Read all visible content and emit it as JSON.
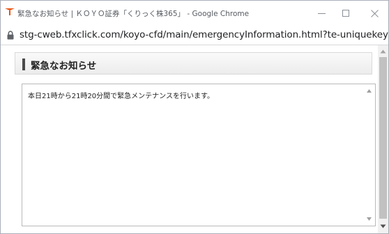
{
  "window": {
    "title": "緊急なお知らせ | ＫＯＹＯ証券「くりっく株365」 - Google Chrome",
    "app_icon": "koyo-logo-icon",
    "controls": {
      "minimize": "minimize-icon",
      "maximize": "maximize-icon",
      "close": "close-icon"
    }
  },
  "address_bar": {
    "secure_icon": "lock-icon",
    "url": "stg-cweb.tfxclick.com/koyo-cfd/main/emergencyInformation.html?te-uniquekey=173..."
  },
  "page": {
    "heading": "緊急なお知らせ",
    "notice": {
      "message": "本日21時から21時20分間で緊急メンテナンスを行います。"
    }
  },
  "colors": {
    "brand": "#e8510f",
    "header_marker": "#4a4a4a",
    "scrollbar_thumb": "#c1c1c1"
  }
}
